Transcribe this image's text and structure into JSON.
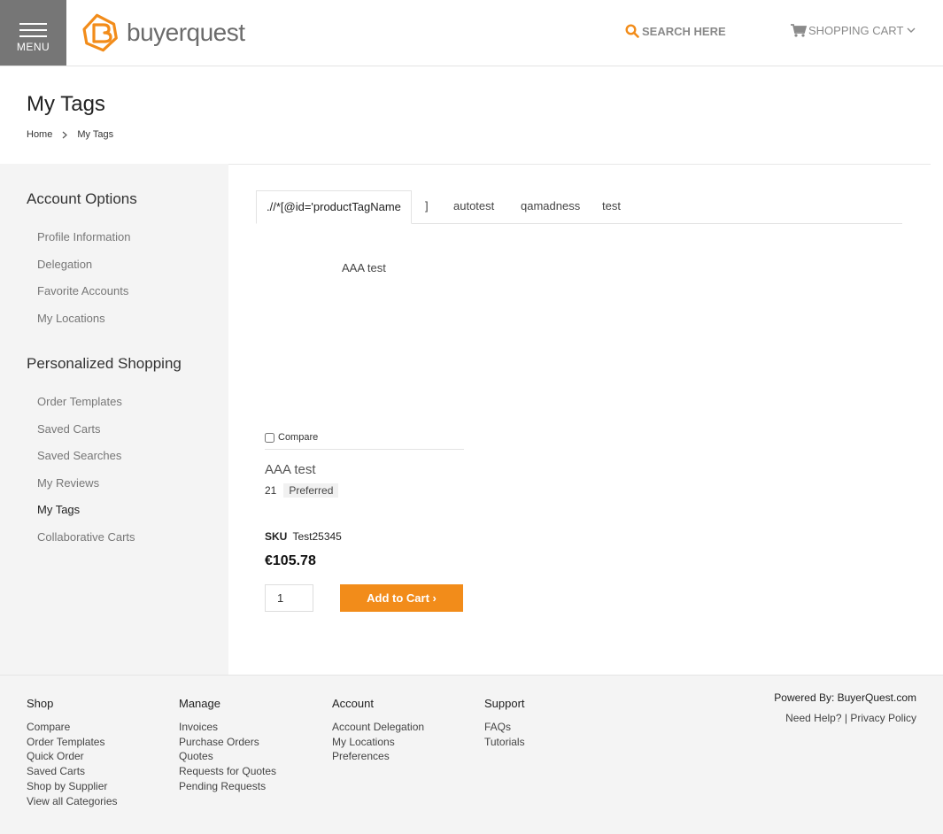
{
  "header": {
    "menu_label": "MENU",
    "logo_text": "buyerquest",
    "search_label": "SEARCH HERE",
    "cart_label": "SHOPPING CART",
    "brand_color": "#f28c1a"
  },
  "page": {
    "title": "My Tags",
    "breadcrumb": [
      "Home",
      "My Tags"
    ]
  },
  "sidebar": {
    "section1_title": "Account Options",
    "section1_items": [
      "Profile Information",
      "Delegation",
      "Favorite Accounts",
      "My Locations"
    ],
    "section2_title": "Personalized Shopping",
    "section2_items": [
      "Order Templates",
      "Saved Carts",
      "Saved Searches",
      "My Reviews",
      "My Tags",
      "Collaborative Carts"
    ],
    "active_item": "My Tags"
  },
  "tabs": [
    ".//*[@id='productTagName",
    "]",
    "autotest",
    "qamadness",
    "test"
  ],
  "tag_list": [
    "AAA test"
  ],
  "product": {
    "compare_label": "Compare",
    "name": "AAA test",
    "rating_count": "21",
    "badge": "Preferred",
    "sku_label": "SKU",
    "sku_value": "Test25345",
    "price": "€105.78",
    "qty": "1",
    "add_to_cart": "Add to Cart ›"
  },
  "footer": {
    "shop": {
      "title": "Shop",
      "links": [
        "Compare",
        "Order Templates",
        "Quick Order",
        "Saved Carts",
        "Shop by Supplier",
        "View all Categories"
      ]
    },
    "manage": {
      "title": "Manage",
      "links": [
        "Invoices",
        "Purchase Orders",
        "Quotes",
        "Requests for Quotes",
        "Pending Requests"
      ]
    },
    "account": {
      "title": "Account",
      "links": [
        "Account Delegation",
        "My Locations",
        "Preferences"
      ]
    },
    "support": {
      "title": "Support",
      "links": [
        "FAQs",
        "Tutorials"
      ]
    },
    "powered_by": "Powered By: BuyerQuest.com",
    "need_help": "Need Help?",
    "separator": "|",
    "privacy": "Privacy Policy"
  }
}
